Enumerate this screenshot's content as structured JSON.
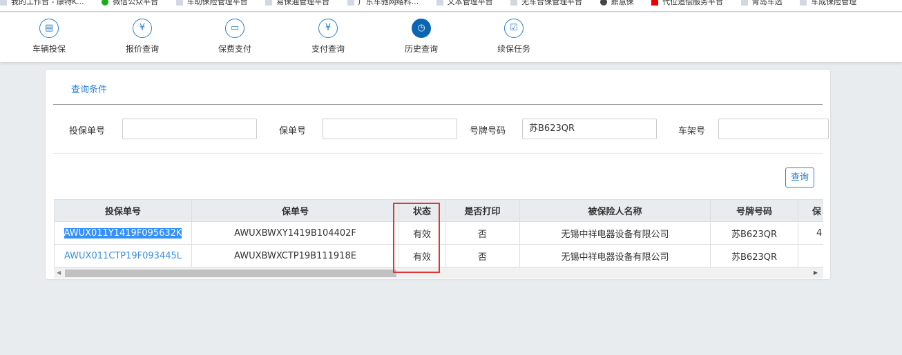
{
  "bookmarks": [
    "我的工作台 - 康特K...",
    "微信公众平台",
    "车助保险管理平台",
    "易保通管理平台",
    "广东车驰网络科...",
    "文本管理平台",
    "无车合保管理平台",
    "鼎慧保",
    "代位追偿服务平台",
    "青岛车选",
    "车成保险管理"
  ],
  "nav": [
    {
      "label": "车辆投保",
      "icon": "document-check-icon",
      "active": false
    },
    {
      "label": "报价查询",
      "icon": "clipboard-yen-icon",
      "active": false
    },
    {
      "label": "保费支付",
      "icon": "card-icon",
      "active": false
    },
    {
      "label": "支付查询",
      "icon": "yen-search-icon",
      "active": false
    },
    {
      "label": "历史查询",
      "icon": "clock-icon",
      "active": true
    },
    {
      "label": "续保任务",
      "icon": "calendar-check-icon",
      "active": false
    }
  ],
  "query": {
    "tab": "查询条件",
    "fields": [
      {
        "label": "投保单号",
        "value": ""
      },
      {
        "label": "保单号",
        "value": ""
      },
      {
        "label": "号牌号码",
        "value": "苏B623QR"
      },
      {
        "label": "车架号",
        "value": ""
      }
    ],
    "button": "查询"
  },
  "table": {
    "headers": [
      "投保单号",
      "保单号",
      "状态",
      "是否打印",
      "被保险人名称",
      "号牌号码",
      "保"
    ],
    "rows": [
      [
        "AWUX011Y1419F095632K",
        "AWUXBWXY1419B104402F",
        "有效",
        "否",
        "无锡中祥电器设备有限公司",
        "苏B623QR",
        "4"
      ],
      [
        "AWUX011CTP19F093445L",
        "AWUXBWXCTP19B111918E",
        "有效",
        "否",
        "无锡中祥电器设备有限公司",
        "苏B623QR",
        ""
      ]
    ]
  },
  "colors": {
    "accent": "#2a7fc9",
    "active_nav": "#0b66b2",
    "highlight": "#e53333"
  }
}
